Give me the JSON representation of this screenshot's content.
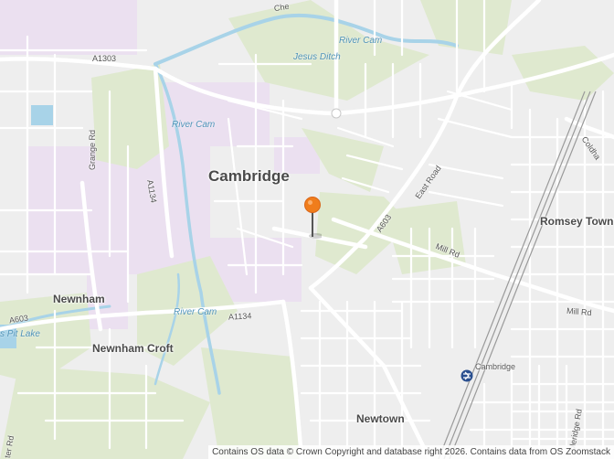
{
  "map": {
    "places": {
      "cambridge": "Cambridge",
      "romsey_town": "Romsey Town",
      "newnham": "Newnham",
      "newnham_croft": "Newnham Croft",
      "newtown": "Newtown"
    },
    "water": {
      "river_cam_ne": "River Cam",
      "jesus_ditch": "Jesus Ditch",
      "river_cam_w": "River Cam",
      "river_cam_s": "River Cam",
      "pit_lake": "s Pit Lake"
    },
    "roads": {
      "a1303": "A1303",
      "a1134_n": "A1134",
      "a1134_s": "A1134",
      "grange_rd": "Grange Rd",
      "east_road": "East Road",
      "a603_e": "A603",
      "a603_w": "A603",
      "mill_rd_1": "Mill Rd",
      "mill_rd_2": "Mill Rd",
      "ter_rd": "ter Rd",
      "coleridge_rd": "oleridge Rd",
      "coldham": "Coldha",
      "chest": "Che",
      "station": "Cambridge"
    },
    "attribution": "Contains OS data © Crown Copyright and database right 2026. Contains data from OS Zoomstack",
    "colors": {
      "background": "#eeeeee",
      "road": "#ffffff",
      "green": "#dfe9cf",
      "university": "#ebe0f0",
      "water": "#a8d3e8",
      "pin": "#f07d1c"
    }
  }
}
